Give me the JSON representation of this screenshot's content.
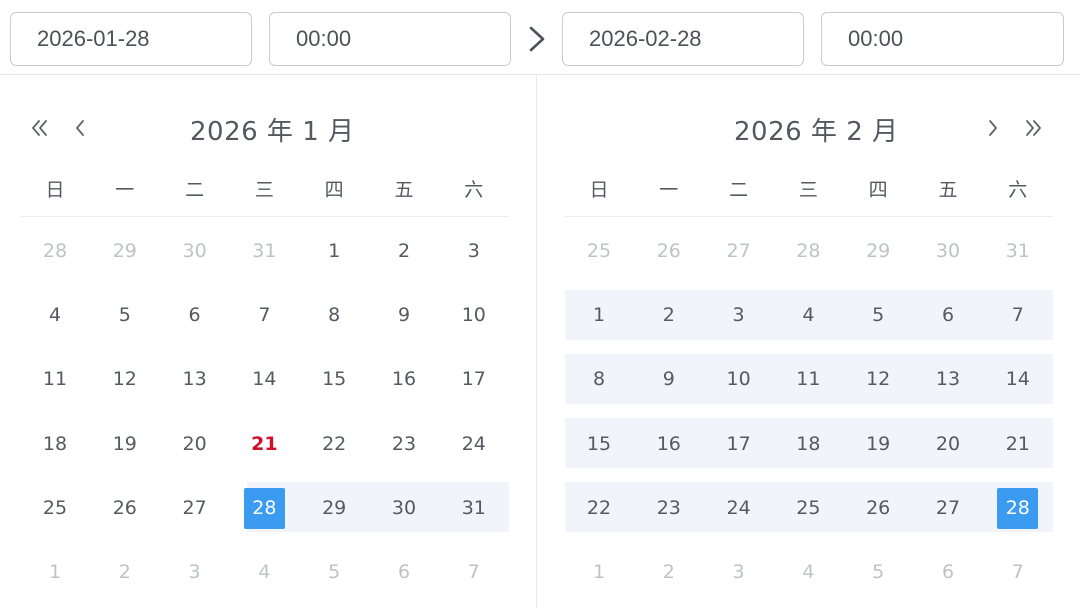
{
  "range": {
    "start_date": "2026-01-28",
    "start_time": "00:00",
    "end_date": "2026-02-28",
    "end_time": "00:00"
  },
  "colors": {
    "accent": "#3a9bf0",
    "today": "#d0102a",
    "range_band": "#f1f5fb",
    "muted_text": "#bfc3c8"
  },
  "icons": {
    "separator": "chevron-right-icon",
    "prev_year": "double-chevron-left-icon",
    "prev_month": "chevron-left-icon",
    "next_month": "chevron-right-icon",
    "next_year": "double-chevron-right-icon"
  },
  "weekdays": [
    "日",
    "一",
    "二",
    "三",
    "四",
    "五",
    "六"
  ],
  "left": {
    "title": "2026 年 1 月",
    "rows": [
      [
        {
          "d": "28",
          "m": 1
        },
        {
          "d": "29",
          "m": 1
        },
        {
          "d": "30",
          "m": 1
        },
        {
          "d": "31",
          "m": 1
        },
        {
          "d": "1"
        },
        {
          "d": "2"
        },
        {
          "d": "3"
        }
      ],
      [
        {
          "d": "4"
        },
        {
          "d": "5"
        },
        {
          "d": "6"
        },
        {
          "d": "7"
        },
        {
          "d": "8"
        },
        {
          "d": "9"
        },
        {
          "d": "10"
        }
      ],
      [
        {
          "d": "11"
        },
        {
          "d": "12"
        },
        {
          "d": "13"
        },
        {
          "d": "14"
        },
        {
          "d": "15"
        },
        {
          "d": "16"
        },
        {
          "d": "17"
        }
      ],
      [
        {
          "d": "18"
        },
        {
          "d": "19"
        },
        {
          "d": "20"
        },
        {
          "d": "21",
          "today": 1
        },
        {
          "d": "22"
        },
        {
          "d": "23"
        },
        {
          "d": "24"
        }
      ],
      [
        {
          "d": "25"
        },
        {
          "d": "26"
        },
        {
          "d": "27"
        },
        {
          "d": "28",
          "sel": 1
        },
        {
          "d": "29"
        },
        {
          "d": "30"
        },
        {
          "d": "31"
        }
      ],
      [
        {
          "d": "1",
          "m": 1
        },
        {
          "d": "2",
          "m": 1
        },
        {
          "d": "3",
          "m": 1
        },
        {
          "d": "4",
          "m": 1
        },
        {
          "d": "5",
          "m": 1
        },
        {
          "d": "6",
          "m": 1
        },
        {
          "d": "7",
          "m": 1
        }
      ]
    ]
  },
  "right": {
    "title": "2026 年 2 月",
    "rows": [
      [
        {
          "d": "25",
          "m": 1
        },
        {
          "d": "26",
          "m": 1
        },
        {
          "d": "27",
          "m": 1
        },
        {
          "d": "28",
          "m": 1
        },
        {
          "d": "29",
          "m": 1
        },
        {
          "d": "30",
          "m": 1
        },
        {
          "d": "31",
          "m": 1
        }
      ],
      [
        {
          "d": "1"
        },
        {
          "d": "2"
        },
        {
          "d": "3"
        },
        {
          "d": "4"
        },
        {
          "d": "5"
        },
        {
          "d": "6"
        },
        {
          "d": "7"
        }
      ],
      [
        {
          "d": "8"
        },
        {
          "d": "9"
        },
        {
          "d": "10"
        },
        {
          "d": "11"
        },
        {
          "d": "12"
        },
        {
          "d": "13"
        },
        {
          "d": "14"
        }
      ],
      [
        {
          "d": "15"
        },
        {
          "d": "16"
        },
        {
          "d": "17"
        },
        {
          "d": "18"
        },
        {
          "d": "19"
        },
        {
          "d": "20"
        },
        {
          "d": "21"
        }
      ],
      [
        {
          "d": "22"
        },
        {
          "d": "23"
        },
        {
          "d": "24"
        },
        {
          "d": "25"
        },
        {
          "d": "26"
        },
        {
          "d": "27"
        },
        {
          "d": "28",
          "sel": 1
        }
      ],
      [
        {
          "d": "1",
          "m": 1
        },
        {
          "d": "2",
          "m": 1
        },
        {
          "d": "3",
          "m": 1
        },
        {
          "d": "4",
          "m": 1
        },
        {
          "d": "5",
          "m": 1
        },
        {
          "d": "6",
          "m": 1
        },
        {
          "d": "7",
          "m": 1
        }
      ]
    ]
  }
}
